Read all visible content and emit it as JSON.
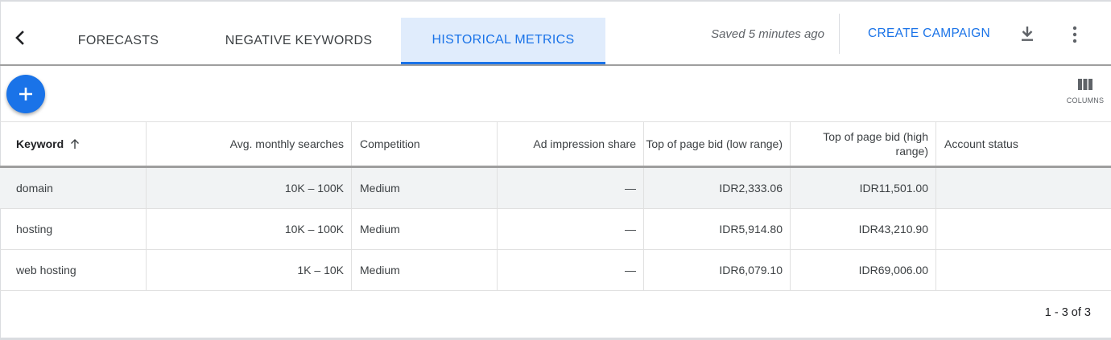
{
  "header": {
    "tabs": [
      {
        "label": "FORECASTS"
      },
      {
        "label": "NEGATIVE KEYWORDS"
      },
      {
        "label": "HISTORICAL METRICS",
        "active": true
      }
    ],
    "saved_status": "Saved 5 minutes ago",
    "create_campaign_label": "CREATE CAMPAIGN",
    "icons": {
      "back": "chevron-left-icon",
      "download": "download-icon",
      "more": "more-vert-icon"
    }
  },
  "toolbar": {
    "add_icon": "plus-icon",
    "columns_label": "COLUMNS",
    "columns_icon": "columns-icon"
  },
  "table": {
    "columns": [
      "Keyword",
      "Avg. monthly searches",
      "Competition",
      "Ad impression share",
      "Top of page bid (low range)",
      "Top of page bid (high range)",
      "Account status"
    ],
    "sort": {
      "column": "Keyword",
      "direction": "ascending"
    },
    "rows": [
      {
        "keyword": "domain",
        "searches": "10K – 100K",
        "competition": "Medium",
        "impression_share": "—",
        "bid_low": "IDR2,333.06",
        "bid_high": "IDR11,501.00",
        "account_status": ""
      },
      {
        "keyword": "hosting",
        "searches": "10K – 100K",
        "competition": "Medium",
        "impression_share": "—",
        "bid_low": "IDR5,914.80",
        "bid_high": "IDR43,210.90",
        "account_status": ""
      },
      {
        "keyword": "web hosting",
        "searches": "1K – 10K",
        "competition": "Medium",
        "impression_share": "—",
        "bid_low": "IDR6,079.10",
        "bid_high": "IDR69,006.00",
        "account_status": ""
      }
    ]
  },
  "pagination": {
    "text": "1 - 3 of 3"
  },
  "colors": {
    "accent": "#1a73e8",
    "active_tab_bg": "#e0ecfc",
    "row_highlight": "#f1f3f4"
  }
}
